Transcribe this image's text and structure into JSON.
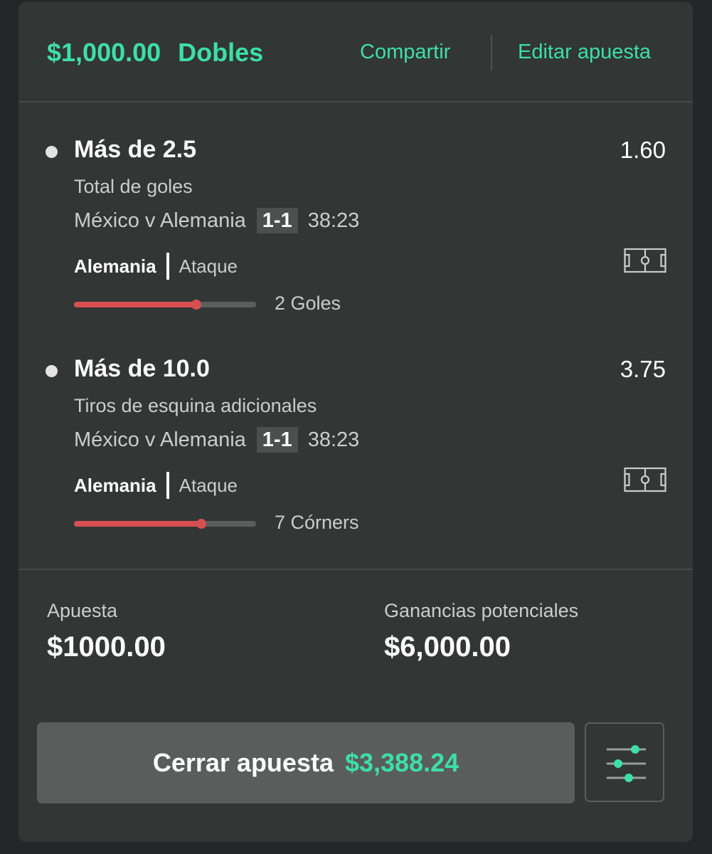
{
  "header": {
    "stake_amount": "$1,000.00",
    "bet_type": "Dobles",
    "share_label": "Compartir",
    "edit_label": "Editar apuesta"
  },
  "selections": [
    {
      "market": "Más de 2.5",
      "odds": "1.60",
      "market_type": "Total de goles",
      "event": "México v Alemania",
      "score": "1-1",
      "clock": "38:23",
      "team": "Alemania",
      "stat_type": "Ataque",
      "progress": 0.67,
      "progress_label": "2 Goles",
      "icon": "football-pitch-icon"
    },
    {
      "market": "Más de 10.0",
      "odds": "3.75",
      "market_type": "Tiros de esquina adicionales",
      "event": "México v Alemania",
      "score": "1-1",
      "clock": "38:23",
      "team": "Alemania",
      "stat_type": "Ataque",
      "progress": 0.7,
      "progress_label": "7 Córners",
      "icon": "football-pitch-icon"
    }
  ],
  "summary": {
    "stake_label": "Apuesta",
    "stake_value": "$1000.00",
    "returns_label": "Ganancias potenciales",
    "returns_value": "$6,000.00"
  },
  "cashout": {
    "label": "Cerrar apuesta",
    "amount": "$3,388.24"
  },
  "settings_icon": "sliders-icon",
  "colors": {
    "accent": "#3ddfa7",
    "progress": "#d84f51",
    "card": "#323635",
    "background": "#242727"
  }
}
